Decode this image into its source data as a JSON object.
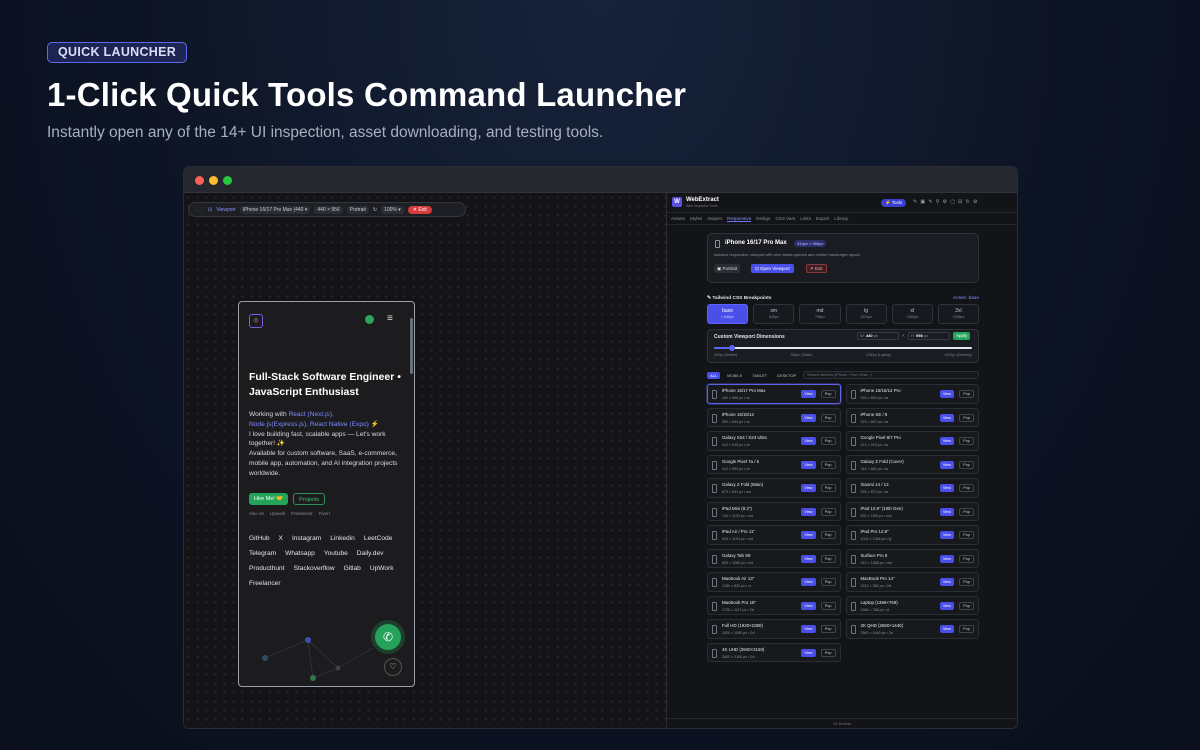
{
  "hero": {
    "badge": "QUICK LAUNCHER",
    "title": "1-Click Quick Tools Command Launcher",
    "subtitle": "Instantly open any of the 14+ UI inspection, asset downloading, and testing tools."
  },
  "window": {
    "dots": [
      "#ff5f57",
      "#febc2e",
      "#28c840"
    ]
  },
  "viewport_toolbar": {
    "label": "Viewport",
    "device": "iPhone 16/17 Pro Max (440",
    "width": "440",
    "height": "956",
    "orientation": "Portrait",
    "zoom": "100%",
    "exit": "Exit"
  },
  "phone": {
    "heading": "Full-Stack Software Engineer • JavaScript Enthusiast",
    "intro_prefix": "Working with ",
    "tech_1": "React (Next.js),",
    "tech_2": "Node.js(Express.js),",
    "tech_3": "React Native (Expo)",
    "tech_suffix": " ⚡",
    "line_2": "I love building fast, scalable apps — Let's work together! ✨",
    "line_3": "Available for custom software, SaaS, e-commerce, mobile app, automation, and AI integration projects worldwide.",
    "hire_button": "Hire Me! 🤝",
    "projects_button": "Projects",
    "also_on": "Also on",
    "platforms": [
      "Upwork",
      "Freelancer",
      "Fiverr"
    ],
    "links": [
      "GitHub",
      "X",
      "Instagram",
      "Linkedin",
      "LeetCode",
      "Telegram",
      "Whatsapp",
      "Youtube",
      "Daily.dev",
      "Producthunt",
      "Stackoverflow",
      "Gitlab",
      "UpWork",
      "Freelancer"
    ]
  },
  "panel": {
    "app_name": "WebExtract",
    "app_sub": "Web Inspector Tools",
    "tools_button": "Tools",
    "tabs": [
      "Assets",
      "Styles",
      "Inspect",
      "Responsive",
      "Design",
      "CSS Vars",
      "Links",
      "Export",
      "Library"
    ],
    "active_tab": "Responsive",
    "device_card": {
      "name": "iPhone 16/17 Pro Max",
      "dims": "414px × 956px",
      "description": "Isolated responsive viewport with real media queries and mobile hamburger layout.",
      "portrait": "Portrait",
      "open": "Open Viewport",
      "exit": "Exit"
    },
    "breakpoints_title": "Tailwind CSS Breakpoints",
    "breakpoints_active": "Active: base",
    "breakpoints": [
      {
        "name": "base",
        "size": "< 640px"
      },
      {
        "name": "sm",
        "size": "640px"
      },
      {
        "name": "md",
        "size": "768px"
      },
      {
        "name": "lg",
        "size": "1024px"
      },
      {
        "name": "xl",
        "size": "1280px"
      },
      {
        "name": "2xl",
        "size": "1536px"
      }
    ],
    "custom": {
      "title": "Custom Viewport Dimensions",
      "w_label": "W:",
      "w_value": "440",
      "h_label": "H:",
      "h_value": "956",
      "unit": "px",
      "apply": "Apply",
      "slider_value": 0.07,
      "scale": [
        "320px (Mobile)",
        "768px (Tablet)",
        "1280px (Laptop)",
        "1920px (Desktop)"
      ]
    },
    "device_filters": [
      "ALL",
      "MOBILE",
      "TABLET",
      "DESKTOP"
    ],
    "search_placeholder": "Search devices (iPhone, Pixel, iPad...)",
    "view_label": "View",
    "pop_label": "Pop",
    "devices": [
      {
        "name": "iPhone 16/17 Pro Max",
        "size": "440 × 956 px • xs"
      },
      {
        "name": "iPhone 15/15/14 Pro",
        "size": "393 × 852 px • xs"
      },
      {
        "name": "iPhone 16/15/12",
        "size": "390 × 844 px • xs"
      },
      {
        "name": "iPhone SE / 8",
        "size": "375 × 667 px • xs"
      },
      {
        "name": "Galaxy S24 / S23 Ultra",
        "size": "412 × 915 px • xs"
      },
      {
        "name": "Google Pixel 8/7 Pro",
        "size": "412 × 915 px • xs"
      },
      {
        "name": "Google Pixel 7a / 6",
        "size": "412 × 892 px • xs"
      },
      {
        "name": "Galaxy Z Fold (Cover)",
        "size": "344 × 882 px • xs"
      },
      {
        "name": "Galaxy Z Fold (Main)",
        "size": "673 × 841 px • sm"
      },
      {
        "name": "Xiaomi 14 / 13",
        "size": "393 × 873 px • xs"
      },
      {
        "name": "iPad Mini (8.3\")",
        "size": "744 × 1133 px • md"
      },
      {
        "name": "iPad 10.9\" (10th Gen)",
        "size": "820 × 1180 px • md"
      },
      {
        "name": "iPad Air / Pro 11\"",
        "size": "834 × 1194 px • md"
      },
      {
        "name": "iPad Pro 12.9\"",
        "size": "1024 × 1366 px • lg"
      },
      {
        "name": "Galaxy Tab S9",
        "size": "800 × 1280 px • md"
      },
      {
        "name": "Surface Pro 9",
        "size": "912 × 1368 px • md"
      },
      {
        "name": "MacBook Air 13\"",
        "size": "1280 × 832 px • xl"
      },
      {
        "name": "MacBook Pro 14\"",
        "size": "1512 × 982 px • 2xl"
      },
      {
        "name": "MacBook Pro 16\"",
        "size": "1728 × 1117 px • 2xl"
      },
      {
        "name": "Laptop (1366×768)",
        "size": "1366 × 768 px • xl"
      },
      {
        "name": "Full HD (1920×1080)",
        "size": "1920 × 1080 px • 2xl"
      },
      {
        "name": "2K QHD (2560×1440)",
        "size": "2560 × 1440 px • 2xl"
      },
      {
        "name": "4K UHD (3840×2160)",
        "size": "3840 × 2160 px • 2xl"
      }
    ],
    "footer": "14 Sheets"
  }
}
